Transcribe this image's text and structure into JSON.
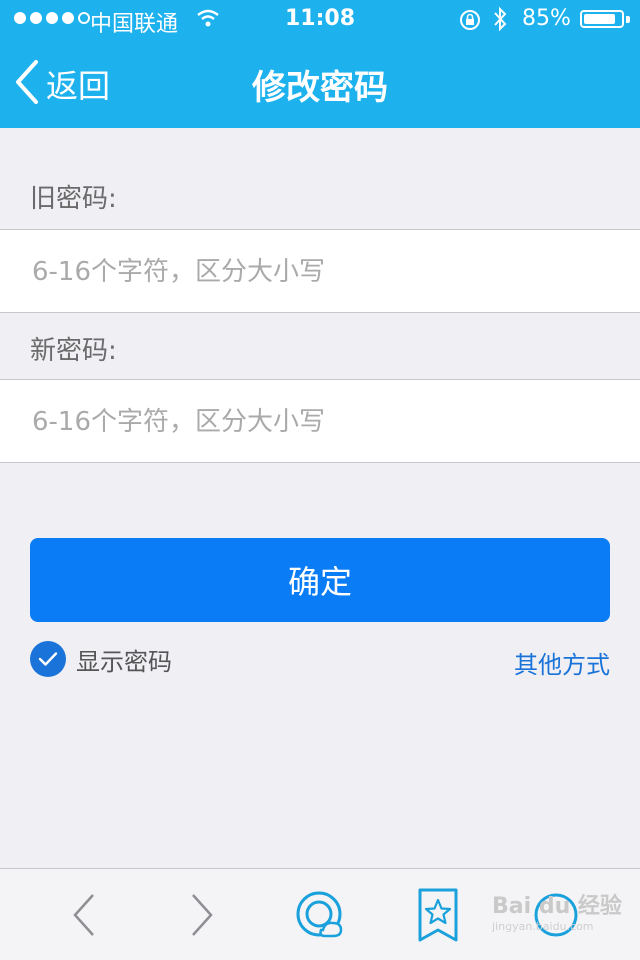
{
  "status_bar": {
    "carrier": "中国联通",
    "time": "11:08",
    "battery_percent": "85%",
    "battery_level": 0.85,
    "signal_strength": 4,
    "signal_max": 5
  },
  "nav": {
    "back_label": "返回",
    "title": "修改密码"
  },
  "form": {
    "old_password_label": "旧密码:",
    "old_password_placeholder": "6-16个字符，区分大小写",
    "new_password_label": "新密码:",
    "new_password_placeholder": "6-16个字符，区分大小写",
    "confirm_label": "确定",
    "show_password_label": "显示密码",
    "show_password_checked": true,
    "other_methods_label": "其他方式"
  },
  "toolbar": {
    "icons": [
      "back-arrow-icon",
      "forward-arrow-icon",
      "chat-cloud-icon",
      "bookmark-star-icon",
      "menu-icon"
    ]
  },
  "watermark": {
    "text": "Bai du 经验",
    "sub": "jingyan.baidu.com"
  },
  "colors": {
    "nav_bg": "#1db1ee",
    "button_bg": "#0a7cf6",
    "link": "#1a73d9",
    "page_bg": "#efeff4"
  }
}
